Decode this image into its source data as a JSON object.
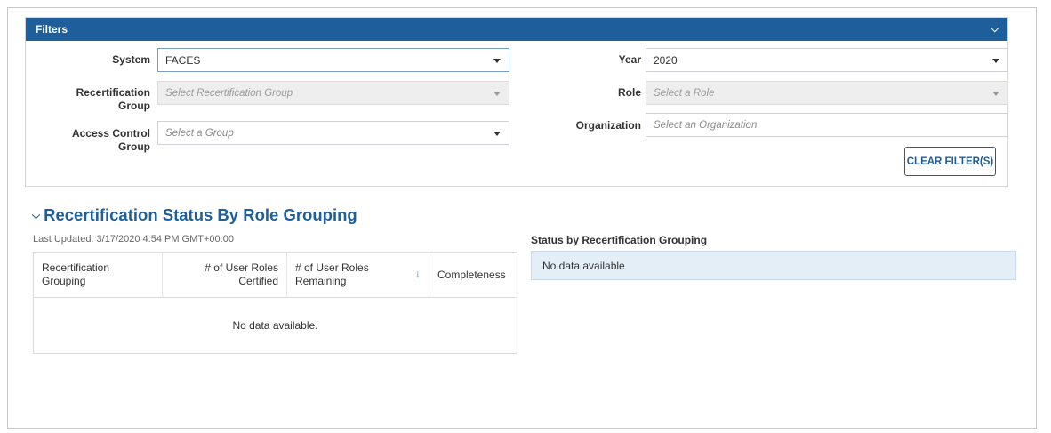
{
  "filters": {
    "title": "Filters",
    "system": {
      "label": "System",
      "value": "FACES"
    },
    "recert_group": {
      "label": "Recertification Group",
      "placeholder": "Select Recertification Group"
    },
    "access_group": {
      "label": "Access Control Group",
      "placeholder": "Select a Group"
    },
    "year": {
      "label": "Year",
      "value": "2020"
    },
    "role": {
      "label": "Role",
      "placeholder": "Select a Role"
    },
    "organization": {
      "label": "Organization",
      "placeholder": "Select an Organization"
    },
    "clear_label": "CLEAR FILTER(S)"
  },
  "section": {
    "title": "Recertification Status By Role Grouping",
    "last_updated": "Last Updated: 3/17/2020 4:54 PM GMT+00:00"
  },
  "grid": {
    "columns": [
      "Recertification Grouping",
      "# of User Roles Certified",
      "# of User Roles Remaining",
      "Completeness"
    ],
    "empty": "No data available."
  },
  "status": {
    "title": "Status by Recertification Grouping",
    "empty": "No data available"
  },
  "colors": {
    "accent": "#1e5f9b",
    "status_bg": "#e4eef7"
  }
}
